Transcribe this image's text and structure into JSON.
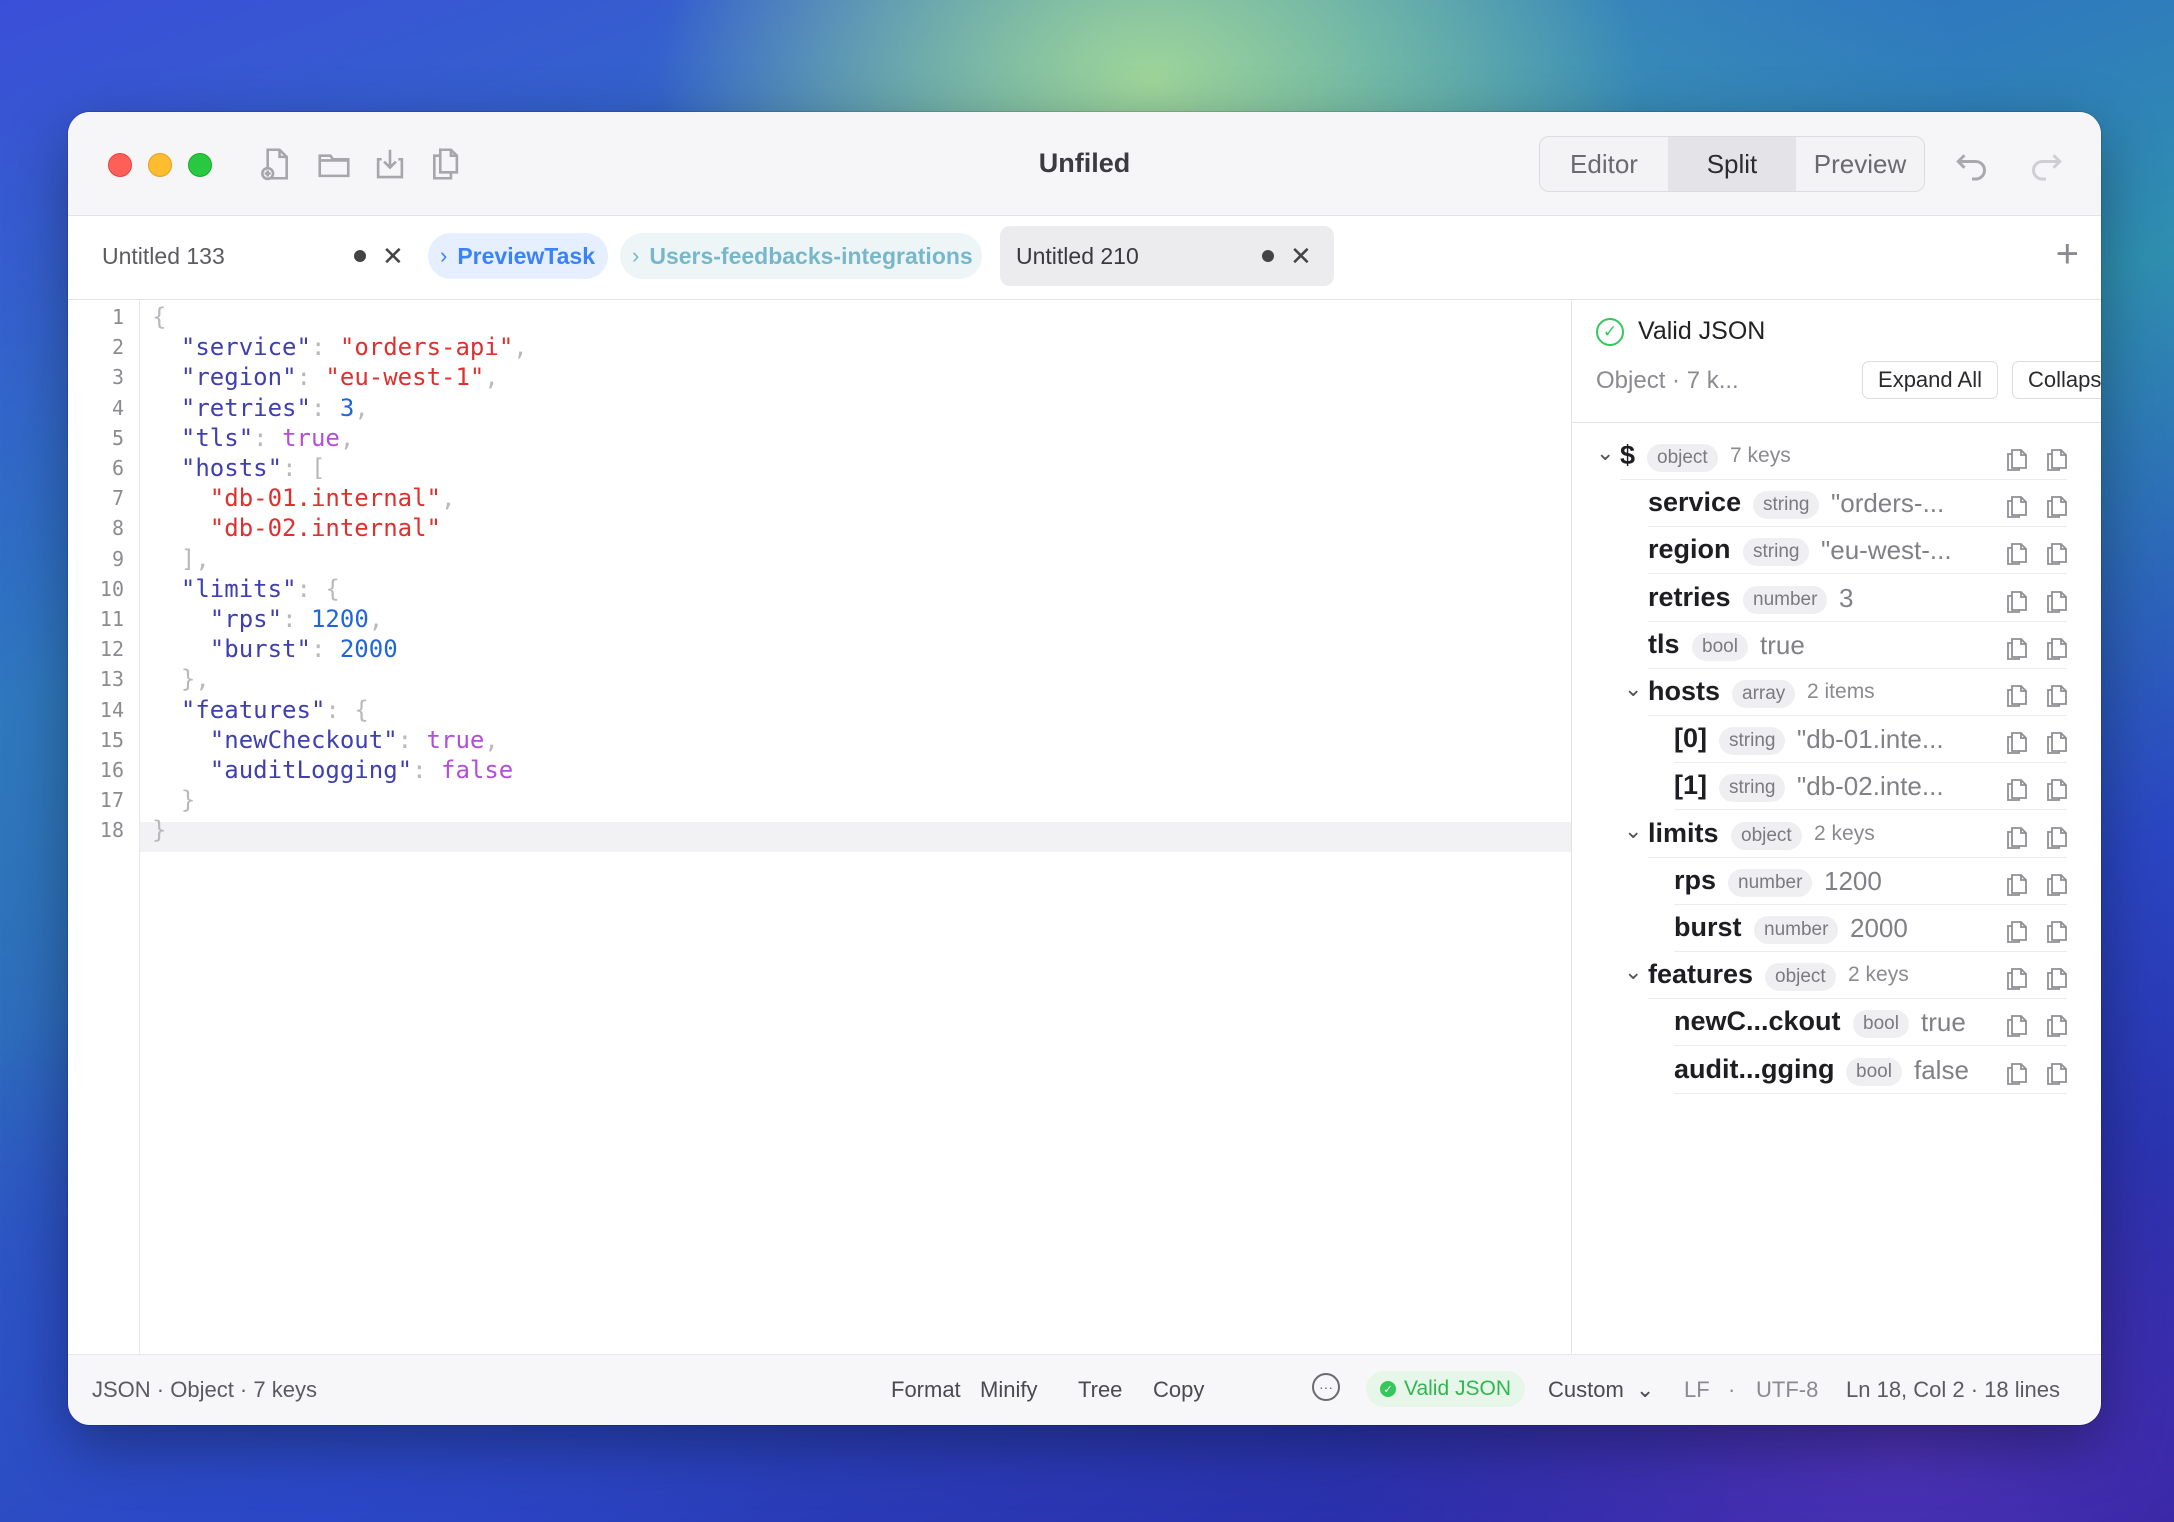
{
  "window": {
    "title": "Unfiled"
  },
  "view_modes": {
    "editor": "Editor",
    "split": "Split",
    "preview": "Preview",
    "active": "Split"
  },
  "tabs": [
    {
      "label": "Untitled 133",
      "modified": true
    },
    {
      "label": "PreviewTask",
      "chevron": "›"
    },
    {
      "label": "Users-feedbacks-integrations",
      "chevron": "›"
    },
    {
      "label": "Untitled 210",
      "modified": true
    }
  ],
  "tab_close": "✕",
  "tab_add": "+",
  "editor": {
    "line_numbers": [
      "1",
      "2",
      "3",
      "4",
      "5",
      "6",
      "7",
      "8",
      "9",
      "10",
      "11",
      "12",
      "13",
      "14",
      "15",
      "16",
      "17",
      "18"
    ]
  },
  "panel": {
    "status": "Valid JSON",
    "summary": "Object · 7 k...",
    "expand_all": "Expand All",
    "collapse_all": "Collapse...",
    "tree": [
      {
        "key": "$",
        "type": "object",
        "meta": "7 keys",
        "caret": "⌄"
      },
      {
        "key": "service",
        "type": "string",
        "value": "\"orders-..."
      },
      {
        "key": "region",
        "type": "string",
        "value": "\"eu-west-..."
      },
      {
        "key": "retries",
        "type": "number",
        "value": "3"
      },
      {
        "key": "tls",
        "type": "bool",
        "value": "true"
      },
      {
        "key": "hosts",
        "type": "array",
        "meta": "2 items",
        "caret": "⌄"
      },
      {
        "key": "[0]",
        "type": "string",
        "value": "\"db-01.inte..."
      },
      {
        "key": "[1]",
        "type": "string",
        "value": "\"db-02.inte..."
      },
      {
        "key": "limits",
        "type": "object",
        "meta": "2 keys",
        "caret": "⌄"
      },
      {
        "key": "rps",
        "type": "number",
        "value": "1200"
      },
      {
        "key": "burst",
        "type": "number",
        "value": "2000"
      },
      {
        "key": "features",
        "type": "object",
        "meta": "2 keys",
        "caret": "⌄"
      },
      {
        "key": "newC...ckout",
        "type": "bool",
        "value": "true"
      },
      {
        "key": "audit...gging",
        "type": "bool",
        "value": "false"
      }
    ]
  },
  "statusbar": {
    "info": "JSON · Object · 7 keys",
    "format": "Format",
    "minify": "Minify",
    "tree": "Tree",
    "copy": "Copy",
    "more": "···",
    "valid": "Valid JSON",
    "valid_check": "✓",
    "indent": "Custom",
    "indent_chevron": "⌄",
    "line_ending": "LF",
    "separator": "·",
    "encoding": "UTF-8",
    "position": "Ln 18, Col 2 · 18 lines"
  },
  "colors": {
    "accent": "#3b82f6",
    "valid": "#34c759",
    "string": "#e0302e",
    "number": "#2066d8",
    "bool": "#b24fd6",
    "key": "#3f3fb0"
  },
  "icons": [
    "new-file-icon",
    "folder-icon",
    "download-icon",
    "duplicate-icon",
    "undo-icon",
    "redo-icon",
    "copy-key-icon",
    "copy-value-icon"
  ]
}
